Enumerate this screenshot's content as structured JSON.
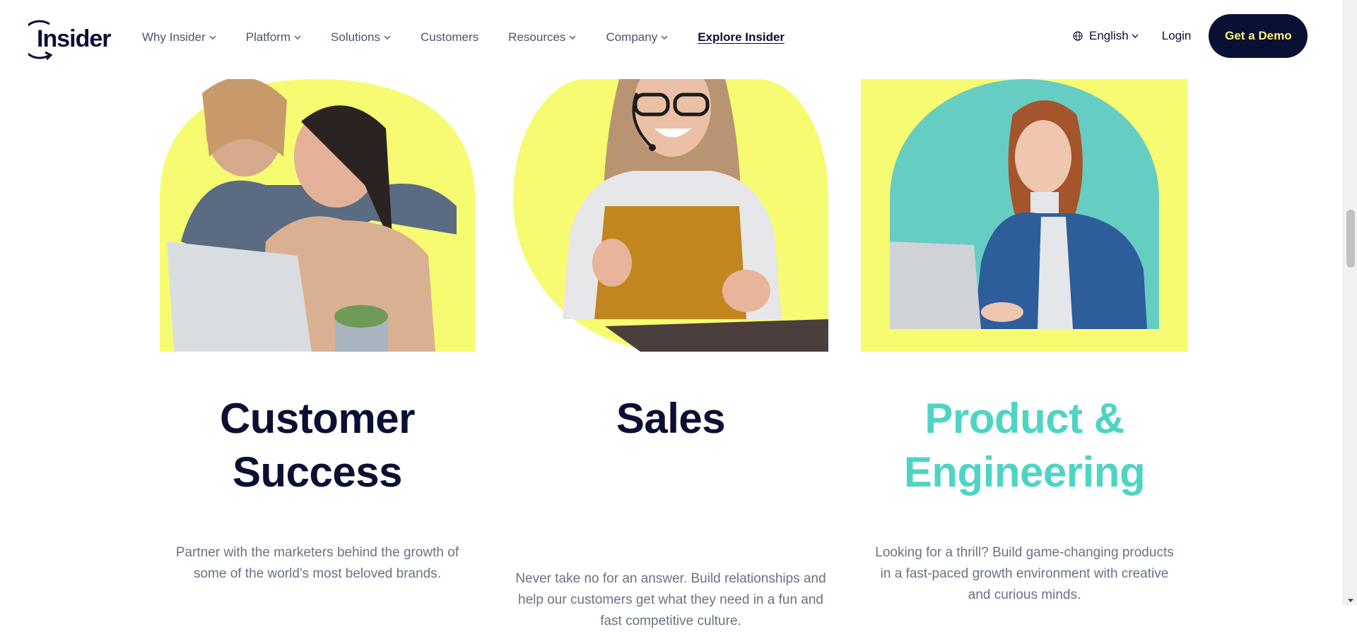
{
  "header": {
    "logo_text": "Insider",
    "nav": [
      {
        "label": "Why Insider",
        "has_dropdown": true
      },
      {
        "label": "Platform",
        "has_dropdown": true
      },
      {
        "label": "Solutions",
        "has_dropdown": true
      },
      {
        "label": "Customers",
        "has_dropdown": false
      },
      {
        "label": "Resources",
        "has_dropdown": true
      },
      {
        "label": "Company",
        "has_dropdown": true
      }
    ],
    "explore_label": "Explore Insider",
    "language": {
      "label": "English",
      "icon": "globe-icon"
    },
    "login_label": "Login",
    "demo_label": "Get a Demo"
  },
  "cards": [
    {
      "title_lines": [
        "Customer",
        "Success"
      ],
      "description_lines": [
        "Partner with the marketers behind the growth of",
        "some of the world's most beloved brands."
      ],
      "title_color": "#0a1033"
    },
    {
      "title_lines": [
        "Sales"
      ],
      "description_lines": [
        "Never take no for an answer. Build relationships and",
        "help our customers get what they need in a fun and",
        "fast competitive culture."
      ],
      "title_color": "#0a1033"
    },
    {
      "title_lines": [
        "Product &",
        "Engineering"
      ],
      "description_lines": [
        "Looking for a thrill? Build game-changing products",
        "in a fast-paced growth environment with creative",
        "and curious minds."
      ],
      "title_color": "#4fd4c4"
    }
  ],
  "colors": {
    "navy": "#0a1033",
    "yellow": "#f7fb72",
    "teal": "#66cdc3",
    "teal_title": "#4fd4c4",
    "body_text": "#6b7186",
    "demo_text": "#fdf27a"
  }
}
